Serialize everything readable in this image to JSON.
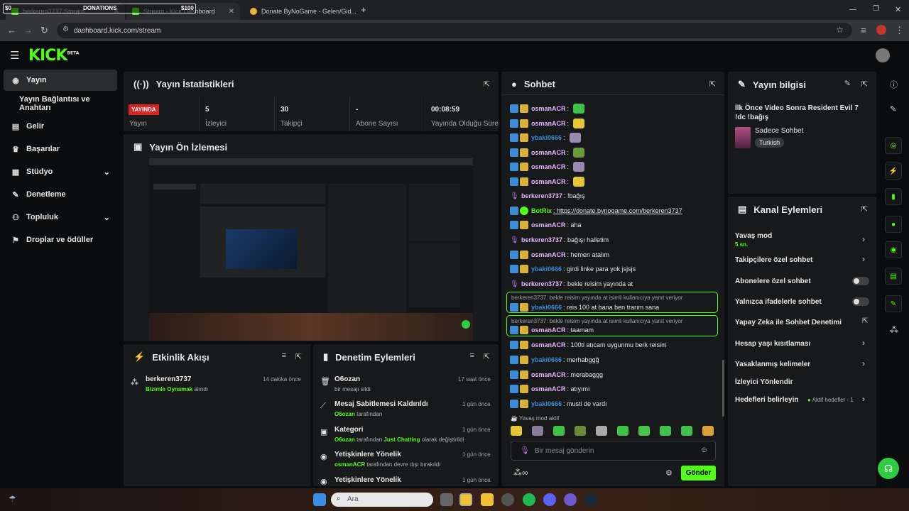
{
  "browser": {
    "tabs": [
      {
        "title": "berkeren3737 Stream"
      },
      {
        "title": "Stream - Kick Dashboard"
      },
      {
        "title": "Donate ByNoGame - Gelen/Gid..."
      }
    ],
    "overlay": {
      "left_amount": "$0",
      "label": "DONATIONS",
      "right_amount": "$100"
    },
    "url": "dashboard.kick.com/stream"
  },
  "app": {
    "logo": "KICK",
    "logo_beta": "BETA"
  },
  "sidebar": {
    "items": [
      {
        "label": "Yayın",
        "icon": "broadcast-icon"
      },
      {
        "label": "Yayın Bağlantısı ve Anahtarı",
        "icon": ""
      },
      {
        "label": "Gelir",
        "icon": "revenue-icon"
      },
      {
        "label": "Başarılar",
        "icon": "trophy-icon"
      },
      {
        "label": "Stüdyo",
        "icon": "studio-icon"
      },
      {
        "label": "Denetleme",
        "icon": "wrench-icon"
      },
      {
        "label": "Topluluk",
        "icon": "community-icon"
      },
      {
        "label": "Droplar ve ödüller",
        "icon": "drops-icon"
      }
    ]
  },
  "stats": {
    "title": "Yayın İstatistikleri",
    "live_badge": "YAYINDA",
    "live_label": "Yayın",
    "items": [
      {
        "value": "5",
        "label": "İzleyici"
      },
      {
        "value": "30",
        "label": "Takipçi"
      },
      {
        "value": "-",
        "label": "Abone Sayısı"
      },
      {
        "value": "00:08:59",
        "label": "Yayında Olduğu Süre"
      }
    ]
  },
  "preview": {
    "title": "Yayın Ön İzlemesi"
  },
  "activity": {
    "title": "Etkinlik Akışı",
    "items": [
      {
        "user": "berkeren3737",
        "time": "14 dakika önce",
        "highlight": "Bizimle Oynamak",
        "suffix": " alındı"
      }
    ]
  },
  "moderation": {
    "title": "Denetim Eylemleri",
    "items": [
      {
        "title": "O6ozan",
        "time": "17 saat önce",
        "pre": "",
        "hl": "",
        "rest": "bir mesajı sildi",
        "hl2": "",
        "rest2": ""
      },
      {
        "title": "Mesaj Sabitlemesi Kaldırıldı",
        "time": "1 gün önce",
        "pre": "",
        "hl": "O6ozan",
        "rest": " tarafından",
        "hl2": "",
        "rest2": ""
      },
      {
        "title": "Kategori",
        "time": "1 gün önce",
        "pre": "",
        "hl": "O6ozan",
        "rest": " tarafından ",
        "hl2": "Just Chatting",
        "rest2": " olarak değiştirildi"
      },
      {
        "title": "Yetişkinlere Yönelik",
        "time": "1 gün önce",
        "pre": "",
        "hl": "osmanACR",
        "rest": " tarafından devre dışı bırakıldı",
        "hl2": "",
        "rest2": ""
      },
      {
        "title": "Yetişkinlere Yönelik",
        "time": "1 gün önce",
        "pre": "",
        "hl": "",
        "rest": "",
        "hl2": "",
        "rest2": ""
      }
    ]
  },
  "chat": {
    "title": "Sohbet",
    "messages": [
      {
        "user": "osmanACR",
        "text": ":",
        "color": "#e8b4ff"
      },
      {
        "user": "osmanACR",
        "text": ":",
        "color": "#e8b4ff"
      },
      {
        "user": "ybaki0666",
        "text": ":",
        "color": "#3b8bd6"
      },
      {
        "user": "osmanACR",
        "text": ":",
        "color": "#e8b4ff"
      },
      {
        "user": "osmanACR",
        "text": ":",
        "color": "#e8b4ff"
      },
      {
        "user": "osmanACR",
        "text": ":",
        "color": "#e8b4ff"
      },
      {
        "user": "berkeren3737",
        "text": ": !bağış",
        "color": "#e8b4ff"
      },
      {
        "user": "BotRix",
        "text": ": https://donate.bynogame.com/berkeren3737",
        "color": "#53fc18"
      },
      {
        "user": "osmanACR",
        "text": ": aha",
        "color": "#e8b4ff"
      },
      {
        "user": "berkeren3737",
        "text": ": bağışı halletim",
        "color": "#e8b4ff"
      },
      {
        "user": "osmanACR",
        "text": ": hemen atalım",
        "color": "#e8b4ff"
      },
      {
        "user": "ybaki0666",
        "text": ": girdi linke para yok jsjsjs",
        "color": "#3b8bd6"
      },
      {
        "user": "berkeren3737",
        "text": ": bekle reisim yayında at",
        "color": "#e8b4ff"
      },
      {
        "user": "ybaki0666",
        "text": ": reis 100 at bana ben trarım sana",
        "color": "#3b8bd6"
      },
      {
        "user": "osmanACR",
        "text": ": taamam",
        "color": "#e8b4ff"
      },
      {
        "user": "osmanACR",
        "text": ": 100tl atıcam uygunmu berk reisim",
        "color": "#e8b4ff"
      },
      {
        "user": "ybaki0666",
        "text": ": merhabggğ",
        "color": "#3b8bd6"
      },
      {
        "user": "osmanACR",
        "text": ": merabaggg",
        "color": "#e8b4ff"
      },
      {
        "user": "osmanACR",
        "text": ": atıyımı",
        "color": "#e8b4ff"
      },
      {
        "user": "ybaki0666",
        "text": ": musti de vardı",
        "color": "#3b8bd6"
      }
    ],
    "reply_note": "berkeren3737: bekle reisim yayında at isimli kullanıcıya yanıt veriyor",
    "slow_mode": "Yavaş mod aktif",
    "input_placeholder": "Bir mesaj gönderin",
    "send_label": "Gönder"
  },
  "stream_info": {
    "title": "Yayın bilgisi",
    "stream_title": "İlk Önce Video Sonra Resident Evil 7 !dc !bağış",
    "category": "Sadece Sohbet",
    "language": "Turkish"
  },
  "channel_actions": {
    "title": "Kanal Eylemleri",
    "slow_mode": "Yavaş mod",
    "slow_mode_value": "5 sn.",
    "followers_only": "Takipçilere özel sohbet",
    "subscribers_only": "Abonelere özel sohbet",
    "emotes_only": "Yalnızca ifadelerle sohbet",
    "ai_moderation": "Yapay Zeka ile Sohbet Denetimi",
    "account_age": "Hesap yaşı kısıtlaması",
    "banned_words": "Yasaklanmış kelimeler",
    "raid": "İzleyici Yönlendir",
    "goals": "Hedefleri belirleyin",
    "goals_status": "Aktif hedefler - 1"
  },
  "taskbar": {
    "search_placeholder": "Ara"
  }
}
